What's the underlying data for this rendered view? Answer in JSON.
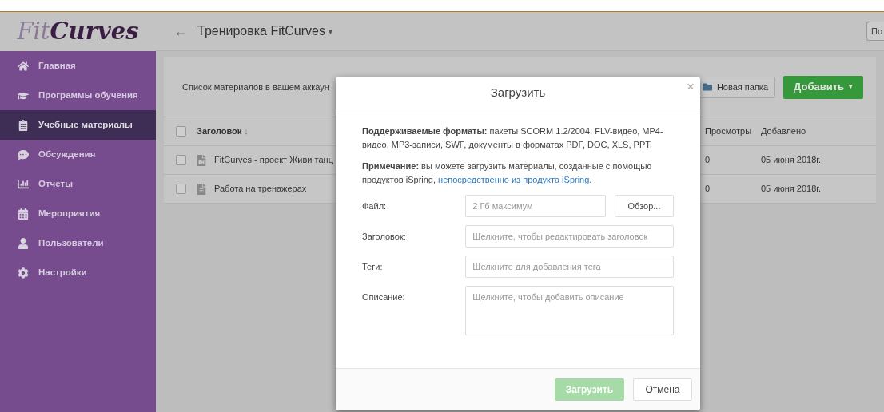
{
  "logo": {
    "part1": "Fit",
    "part2": "Curves"
  },
  "header": {
    "back": "←",
    "title": "Тренировка FitCurves",
    "caret": "▾",
    "right_button": "По"
  },
  "sidebar": {
    "items": [
      {
        "label": "Главная",
        "selected": false
      },
      {
        "label": "Программы обучения",
        "selected": false
      },
      {
        "label": "Учебные материалы",
        "selected": true
      },
      {
        "label": "Обсуждения",
        "selected": false
      },
      {
        "label": "Отчеты",
        "selected": false
      },
      {
        "label": "Мероприятия",
        "selected": false
      },
      {
        "label": "Пользователи",
        "selected": false
      },
      {
        "label": "Настройки",
        "selected": false
      }
    ]
  },
  "toolbar": {
    "text": "Список материалов в вашем аккаун",
    "new_folder": "Новая папка",
    "add": "Добавить",
    "add_caret": "▾"
  },
  "table": {
    "all_checked": false,
    "columns": [
      {
        "label": "Заголовок",
        "sort": "↓"
      },
      {
        "label": "Просмотры"
      },
      {
        "label": "Добавлено"
      }
    ],
    "rows": [
      {
        "title": "FitCurves - проект Живи танц",
        "kind": "video",
        "checked": false,
        "views": "0",
        "added": "05 июня 2018г."
      },
      {
        "title": "Работа на тренажерах",
        "kind": "quiz",
        "checked": false,
        "views": "0",
        "added": "05 июня 2018г."
      }
    ]
  },
  "dialog": {
    "title": "Загрузить",
    "close": "×",
    "formats": "**Поддерживаемые форматы:** пакеты SCORM 1.2/2004, FLV-видео, MP4-видео, MP3-записи, SWF, документы в форматах PDF, DOC, XLS, PPT.",
    "note": "**Примечание:** вы можете загрузить материалы, созданные с помощью продуктов iSpring, ",
    "note_link": "непосредственно из продукта iSpring",
    "note_end": ".",
    "fields": [
      {
        "label": "Файл:",
        "placeholder": "2 Гб максимум",
        "kind": "file",
        "button": "Обзор..."
      },
      {
        "label": "Заголовок:",
        "placeholder": "Щелкните, чтобы редактировать заголовок",
        "kind": "text"
      },
      {
        "label": "Теги:",
        "placeholder": "Щелкните для добавления тега",
        "kind": "text"
      },
      {
        "label": "Описание:",
        "placeholder": "Щелкните, чтобы добавить описание",
        "kind": "textarea"
      }
    ],
    "submit": {
      "label": "Загрузить",
      "disabled": true
    },
    "cancel": "Отмена"
  }
}
